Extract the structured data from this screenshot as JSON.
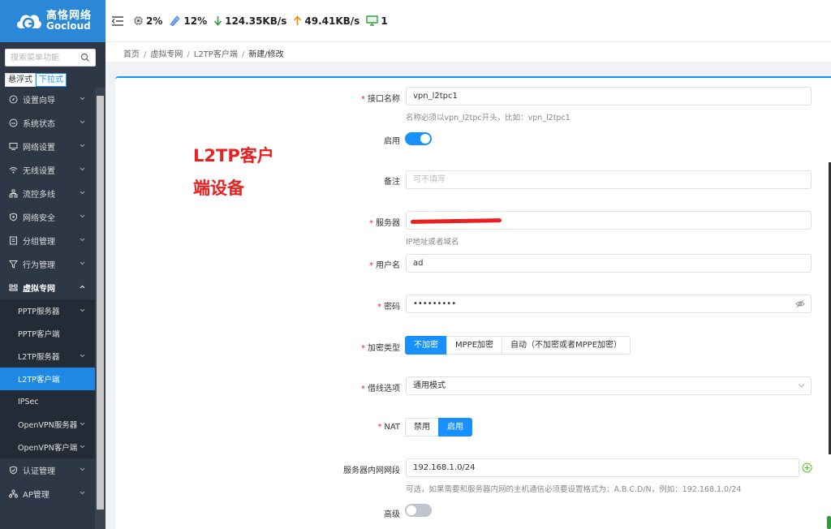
{
  "brand": {
    "name_cn": "高恪网络",
    "name_en": "Gocloud"
  },
  "sidebar": {
    "search_placeholder": "搜索菜单功能",
    "modes": [
      "悬浮式",
      "下拉式"
    ],
    "items": [
      {
        "label": "设置向导",
        "icon": "compass-icon"
      },
      {
        "label": "系统状态",
        "icon": "dashboard-icon"
      },
      {
        "label": "网络设置",
        "icon": "monitor-icon"
      },
      {
        "label": "无线设置",
        "icon": "wifi-icon"
      },
      {
        "label": "流控多线",
        "icon": "network-icon"
      },
      {
        "label": "网络安全",
        "icon": "shield-icon"
      },
      {
        "label": "分组管理",
        "icon": "group-icon"
      },
      {
        "label": "行为管理",
        "icon": "filter-icon"
      },
      {
        "label": "虚拟专网",
        "icon": "vpn-icon"
      }
    ],
    "sub_items": [
      "PPTP服务器",
      "PPTP客户端",
      "L2TP服务器",
      "L2TP客户端",
      "IPSec",
      "OpenVPN服务器",
      "OpenVPN客户端"
    ],
    "bottom_items": [
      {
        "label": "认证管理",
        "icon": "check-shield-icon"
      },
      {
        "label": "AP管理",
        "icon": "ap-icon"
      }
    ]
  },
  "topbar": {
    "cpu": "2%",
    "mem": "12%",
    "download": "124.35KB/s",
    "upload": "49.41KB/s",
    "devices": "1"
  },
  "breadcrumb": [
    "首页",
    "虚拟专网",
    "L2TP客户端",
    "新建/修改"
  ],
  "annotation": "L2TP客户端设备",
  "form": {
    "ifname": {
      "label": "接口名称",
      "value": "vpn_l2tpc1",
      "help": "名称必须以vpn_l2tpc开头，比如：vpn_l2tpc1"
    },
    "enable": {
      "label": "启用"
    },
    "remark": {
      "label": "备注",
      "placeholder": "可不填写"
    },
    "server": {
      "label": "服务器",
      "help": "IP地址或者域名"
    },
    "username": {
      "label": "用户名",
      "value": "ad"
    },
    "password": {
      "label": "密码",
      "value": "•••••••••"
    },
    "encrypt": {
      "label": "加密类型",
      "options": [
        "不加密",
        "MPPE加密",
        "自动（不加密或者MPPE加密）"
      ]
    },
    "route": {
      "label": "借线选项",
      "value": "通用模式"
    },
    "nat": {
      "label": "NAT",
      "options": [
        "禁用",
        "启用"
      ]
    },
    "subnet": {
      "label": "服务器内网网段",
      "value": "192.168.1.0/24",
      "help": "可选，如果需要和服务器内网的主机通信必须要设置格式为：A.B.C.D/N，例如：192.168.1.0/24"
    },
    "advanced": {
      "label": "高级"
    }
  }
}
